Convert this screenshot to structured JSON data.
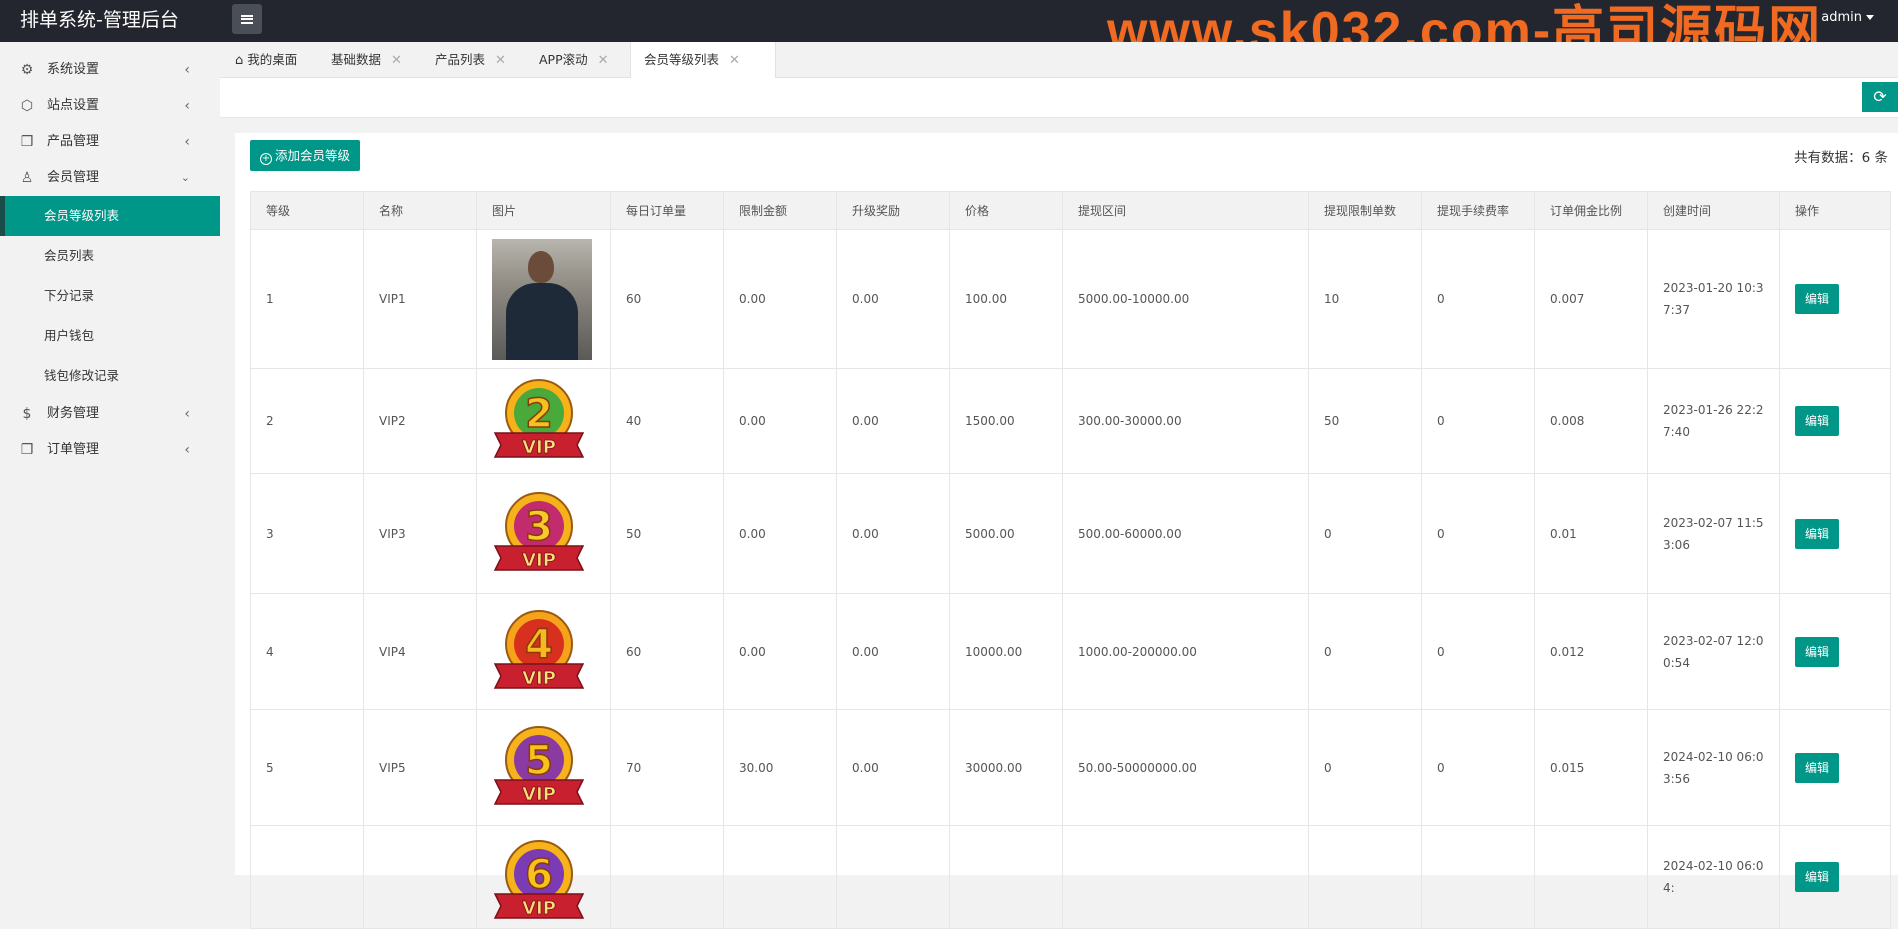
{
  "header": {
    "brand": "排单系统-管理后台",
    "watermark": "www.sk032.com-高司源码网",
    "user": "admin"
  },
  "sidebar": {
    "groups": [
      {
        "label": "系统设置",
        "icon": "gear-icon"
      },
      {
        "label": "站点设置",
        "icon": "site-icon"
      },
      {
        "label": "产品管理",
        "icon": "cube-icon"
      },
      {
        "label": "会员管理",
        "icon": "user-icon"
      }
    ],
    "member_sub": [
      {
        "label": "会员等级列表",
        "active": true
      },
      {
        "label": "会员列表"
      },
      {
        "label": "下分记录"
      },
      {
        "label": "用户钱包"
      },
      {
        "label": "钱包修改记录"
      }
    ],
    "groups_after": [
      {
        "label": "财务管理",
        "icon": "dollar-icon"
      },
      {
        "label": "订单管理",
        "icon": "cube-icon"
      }
    ]
  },
  "tabs": [
    {
      "label": "我的桌面"
    },
    {
      "label": "基础数据"
    },
    {
      "label": "产品列表"
    },
    {
      "label": "APP滚动"
    },
    {
      "label": "会员等级列表",
      "active": true
    }
  ],
  "panel": {
    "add_button": "添加会员等级",
    "total": "共有数据：6 条",
    "edit_label": "编辑"
  },
  "table": {
    "headers": [
      "等级",
      "名称",
      "图片",
      "每日订单量",
      "限制金额",
      "升级奖励",
      "价格",
      "提现区间",
      "提现限制单数",
      "提现手续费率",
      "订单佣金比例",
      "创建时间",
      "操作"
    ],
    "rows": [
      {
        "level": "1",
        "name": "VIP1",
        "image": "photo",
        "daily": "60",
        "limit": "0.00",
        "reward": "0.00",
        "price": "100.00",
        "range": "5000.00-10000.00",
        "limit_count": "10",
        "fee": "0",
        "commission": "0.007",
        "created": "2023-01-20 10:37:37"
      },
      {
        "level": "2",
        "name": "VIP2",
        "image": "vip-2-badge",
        "daily": "40",
        "limit": "0.00",
        "reward": "0.00",
        "price": "1500.00",
        "range": "300.00-30000.00",
        "limit_count": "50",
        "fee": "0",
        "commission": "0.008",
        "created": "2023-01-26 22:27:40"
      },
      {
        "level": "3",
        "name": "VIP3",
        "image": "vip-3-badge",
        "daily": "50",
        "limit": "0.00",
        "reward": "0.00",
        "price": "5000.00",
        "range": "500.00-60000.00",
        "limit_count": "0",
        "fee": "0",
        "commission": "0.01",
        "created": "2023-02-07 11:53:06"
      },
      {
        "level": "4",
        "name": "VIP4",
        "image": "vip-4-badge",
        "daily": "60",
        "limit": "0.00",
        "reward": "0.00",
        "price": "10000.00",
        "range": "1000.00-200000.00",
        "limit_count": "0",
        "fee": "0",
        "commission": "0.012",
        "created": "2023-02-07 12:00:54"
      },
      {
        "level": "5",
        "name": "VIP5",
        "image": "vip-5-badge",
        "daily": "70",
        "limit": "30.00",
        "reward": "0.00",
        "price": "30000.00",
        "range": "50.00-50000000.00",
        "limit_count": "0",
        "fee": "0",
        "commission": "0.015",
        "created": "2024-02-10 06:03:56"
      },
      {
        "level": "",
        "name": "",
        "image": "vip-6-badge",
        "daily": "",
        "limit": "",
        "reward": "",
        "price": "",
        "range": "",
        "limit_count": "",
        "fee": "",
        "commission": "",
        "created": "2024-02-10 06:04:"
      }
    ]
  },
  "colors": {
    "accent": "#009688",
    "topbar": "#23262e",
    "watermark": "#f06a21"
  }
}
